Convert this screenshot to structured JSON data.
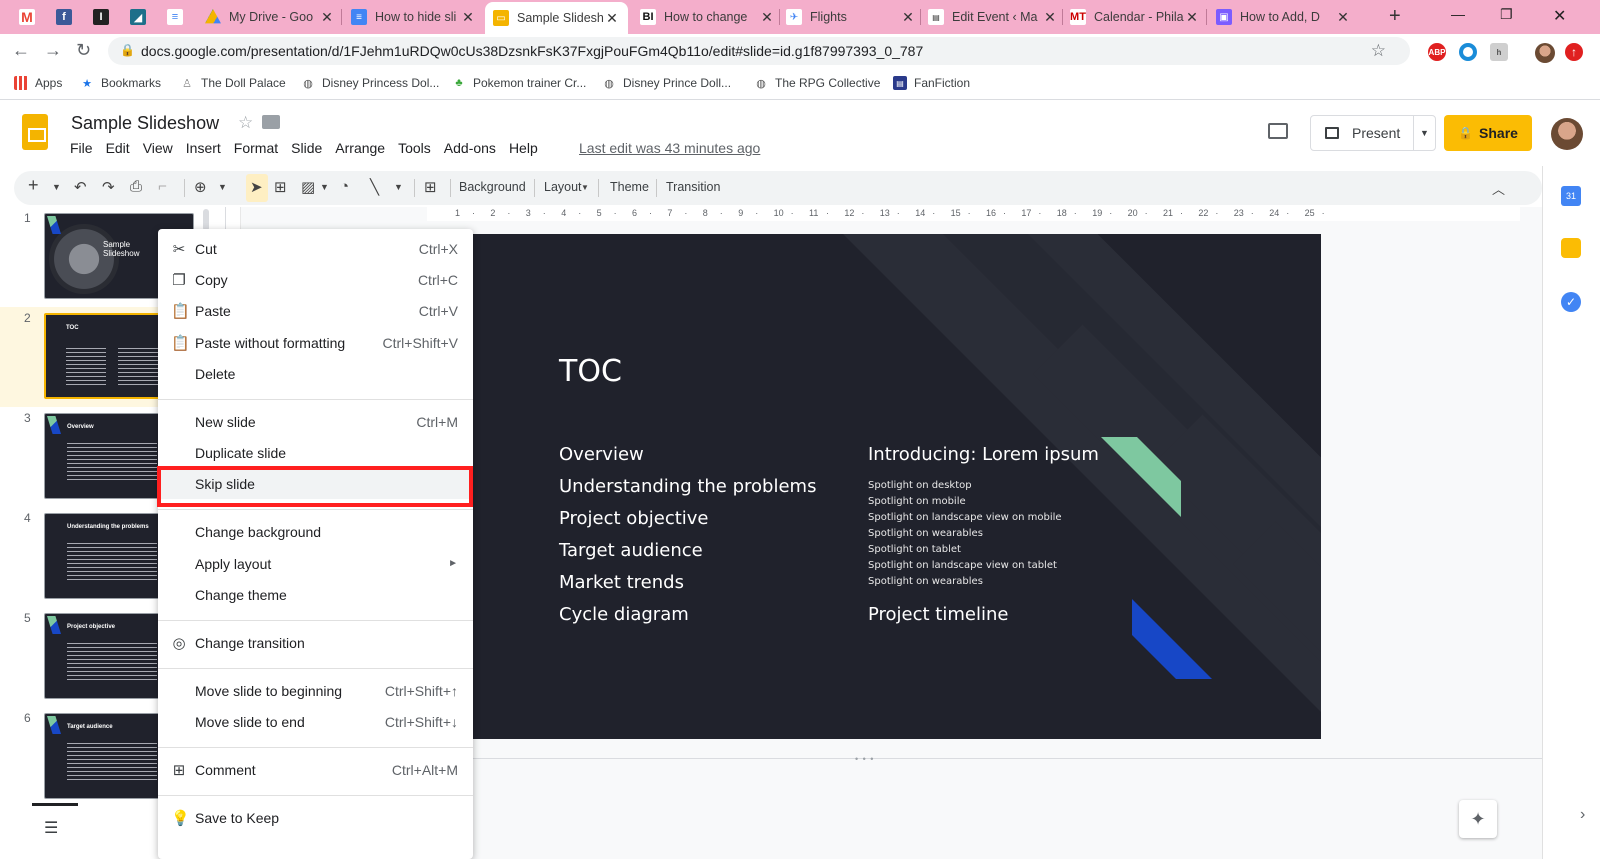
{
  "browser": {
    "tabs": [
      {
        "title": "My Drive - Goo",
        "favicon": "google-drive-icon"
      },
      {
        "title": "How to hide sli",
        "favicon": "google-docs-icon"
      },
      {
        "title": "Sample Slidesh",
        "favicon": "google-slides-icon",
        "active": true
      },
      {
        "title": "How to change",
        "favicon": "business-insider-icon"
      },
      {
        "title": "Flights",
        "favicon": "google-flights-icon"
      },
      {
        "title": "Edit Event ‹ Ma",
        "favicon": "wordpress-event-icon"
      },
      {
        "title": "Calendar - Phila",
        "favicon": "mt-calendar-icon"
      },
      {
        "title": "How to Add, D",
        "favicon": "article-icon"
      }
    ],
    "pinned_tabs": [
      {
        "name": "gmail-icon",
        "glyph": "M",
        "color": "#ea4335"
      },
      {
        "name": "facebook-icon",
        "glyph": "f",
        "color": "#3b5998"
      },
      {
        "name": "instapaper-icon",
        "glyph": "I",
        "color": "#222222"
      },
      {
        "name": "bookmark-app-icon",
        "glyph": "◢",
        "color": "#1d6f8a"
      },
      {
        "name": "google-docs-pin-icon",
        "glyph": "≡",
        "color": "#4285f4"
      }
    ],
    "url": "docs.google.com/presentation/d/1FJehm1uRDQw0cUs38DzsnkFsK37FxgjPouFGm4Qb11o/edit#slide=id.g1f87997393_0_787",
    "bookmarks": [
      {
        "label": "Apps",
        "icon": "apps-grid-icon"
      },
      {
        "label": "Bookmarks",
        "icon": "star-icon"
      },
      {
        "label": "The Doll Palace",
        "icon": "doll-icon"
      },
      {
        "label": "Disney Princess Dol...",
        "icon": "globe-icon"
      },
      {
        "label": "Pokemon trainer Cr...",
        "icon": "leaf-icon"
      },
      {
        "label": "Disney Prince Doll...",
        "icon": "globe-icon"
      },
      {
        "label": "The RPG Collective",
        "icon": "globe-icon"
      },
      {
        "label": "FanFiction",
        "icon": "fanfiction-icon"
      }
    ]
  },
  "app": {
    "doc_title": "Sample Slideshow",
    "menu": [
      "File",
      "Edit",
      "View",
      "Insert",
      "Format",
      "Slide",
      "Arrange",
      "Tools",
      "Add-ons",
      "Help"
    ],
    "last_edit": "Last edit was 43 minutes ago",
    "present_label": "Present",
    "share_label": "Share"
  },
  "toolbar": {
    "background_label": "Background",
    "layout_label": "Layout",
    "theme_label": "Theme",
    "transition_label": "Transition"
  },
  "ruler_marks": [
    "1",
    "2",
    "3",
    "4",
    "5",
    "6",
    "7",
    "8",
    "9",
    "10",
    "11",
    "12",
    "13",
    "14",
    "15",
    "16",
    "17",
    "18",
    "19",
    "20",
    "21",
    "22",
    "23",
    "24",
    "25"
  ],
  "filmstrip": [
    {
      "num": "1",
      "title": "Sample Slideshow"
    },
    {
      "num": "2",
      "title": "TOC"
    },
    {
      "num": "3",
      "title": "Overview"
    },
    {
      "num": "4",
      "title": "Understanding the problems"
    },
    {
      "num": "5",
      "title": "Project objective"
    },
    {
      "num": "6",
      "title": "Target audience"
    }
  ],
  "slide": {
    "title": "TOC",
    "left_items": [
      "Overview",
      "Understanding the problems",
      "Project objective",
      "Target audience",
      "Market trends",
      "Cycle diagram"
    ],
    "right_heading": "Introducing: Lorem ipsum",
    "spotlights": [
      "Spotlight on desktop",
      "Spotlight on mobile",
      "Spotlight on landscape view on mobile",
      "Spotlight on wearables",
      "Spotlight on tablet",
      "Spotlight on landscape view on tablet",
      "Spotlight on wearables"
    ],
    "timeline": "Project timeline",
    "accent_green": "#7ec8a0",
    "accent_blue": "#1747c6",
    "background": "#20222c"
  },
  "context_menu": {
    "items": [
      {
        "label": "Cut",
        "shortcut": "Ctrl+X",
        "icon": "scissors-icon"
      },
      {
        "label": "Copy",
        "shortcut": "Ctrl+C",
        "icon": "copy-icon"
      },
      {
        "label": "Paste",
        "shortcut": "Ctrl+V",
        "icon": "clipboard-icon"
      },
      {
        "label": "Paste without formatting",
        "shortcut": "Ctrl+Shift+V",
        "icon": "clipboard-plain-icon"
      },
      {
        "label": "Delete",
        "shortcut": "",
        "icon": ""
      },
      {
        "label": "New slide",
        "shortcut": "Ctrl+M",
        "icon": ""
      },
      {
        "label": "Duplicate slide",
        "shortcut": "",
        "icon": ""
      },
      {
        "label": "Skip slide",
        "shortcut": "",
        "icon": "",
        "highlighted": true
      },
      {
        "label": "Change background",
        "shortcut": "",
        "icon": ""
      },
      {
        "label": "Apply layout",
        "shortcut": "",
        "icon": "",
        "submenu": true
      },
      {
        "label": "Change theme",
        "shortcut": "",
        "icon": ""
      },
      {
        "label": "Change transition",
        "shortcut": "",
        "icon": "transition-icon"
      },
      {
        "label": "Move slide to beginning",
        "shortcut": "Ctrl+Shift+↑",
        "icon": ""
      },
      {
        "label": "Move slide to end",
        "shortcut": "Ctrl+Shift+↓",
        "icon": ""
      },
      {
        "label": "Comment",
        "shortcut": "Ctrl+Alt+M",
        "icon": "add-comment-icon"
      },
      {
        "label": "Save to Keep",
        "shortcut": "",
        "icon": "keep-bulb-icon"
      }
    ],
    "highlight_color": "#ff1f1f"
  }
}
